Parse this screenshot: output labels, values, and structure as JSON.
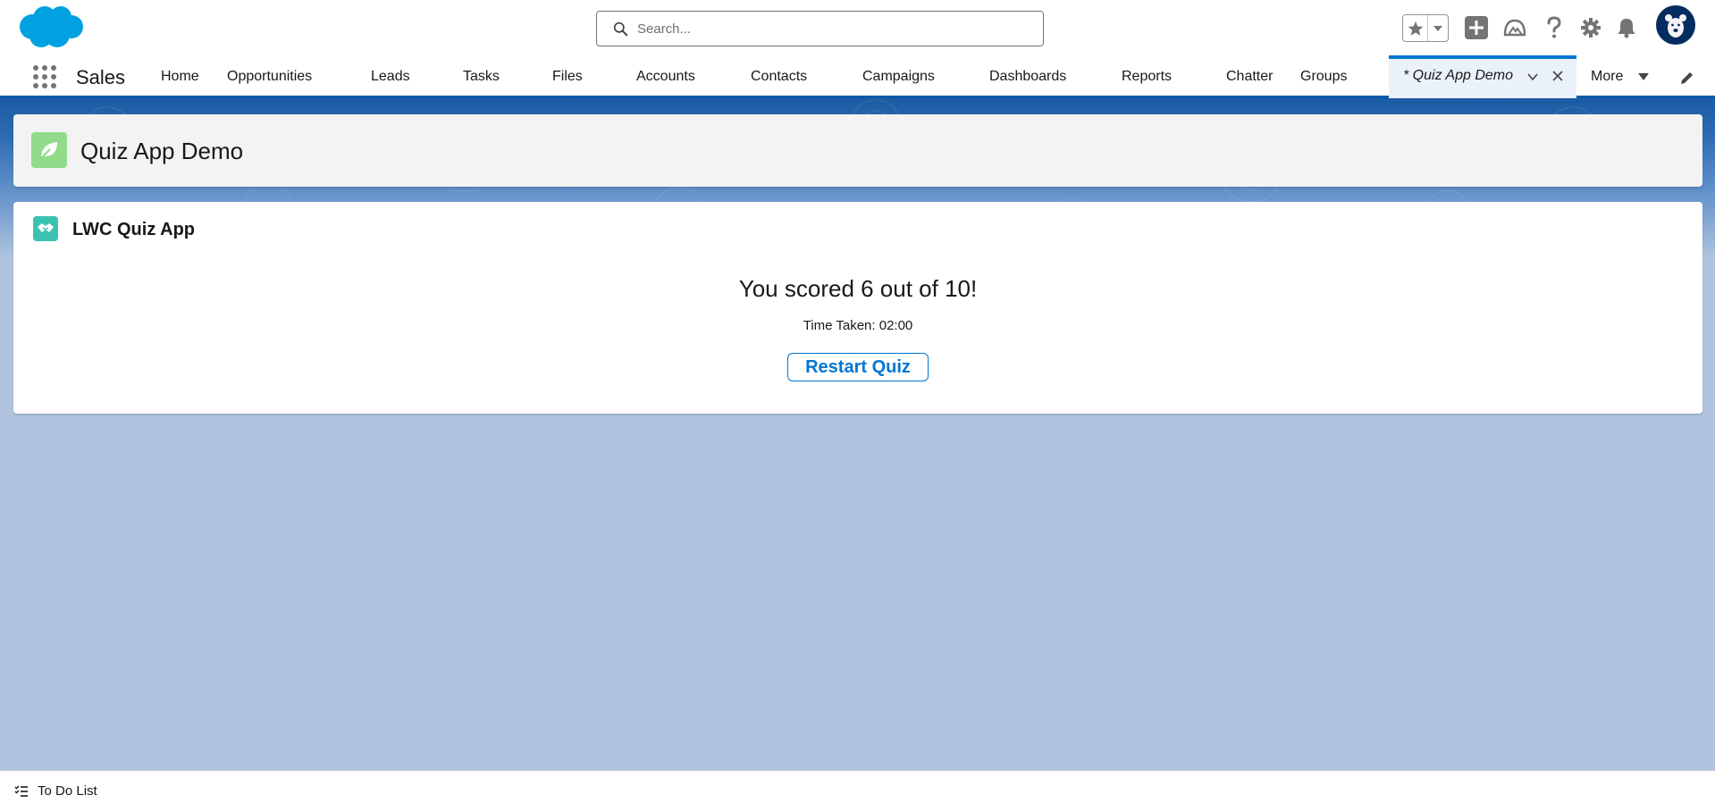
{
  "header": {
    "search_placeholder": "Search..."
  },
  "nav": {
    "app_name": "Sales",
    "items": [
      {
        "label": "Home"
      },
      {
        "label": "Opportunities"
      },
      {
        "label": "Leads"
      },
      {
        "label": "Tasks"
      },
      {
        "label": "Files"
      },
      {
        "label": "Accounts"
      },
      {
        "label": "Contacts"
      },
      {
        "label": "Campaigns"
      },
      {
        "label": "Dashboards"
      },
      {
        "label": "Reports"
      },
      {
        "label": "Chatter"
      },
      {
        "label": "Groups"
      }
    ],
    "active_tab": "* Quiz App Demo",
    "more_label": "More"
  },
  "page": {
    "title": "Quiz App Demo"
  },
  "quiz": {
    "card_title": "LWC Quiz App",
    "score_text": "You scored 6 out of 10!",
    "time_text": "Time Taken: 02:00",
    "restart_label": "Restart Quiz"
  },
  "utility": {
    "todo_label": "To Do List"
  },
  "colors": {
    "brand_blue": "#0176d3",
    "nav_underline": "#0b5cab",
    "page_icon_bg": "#91db8b",
    "card_icon_bg": "#3bc3b1",
    "background": "#b0c4df"
  }
}
